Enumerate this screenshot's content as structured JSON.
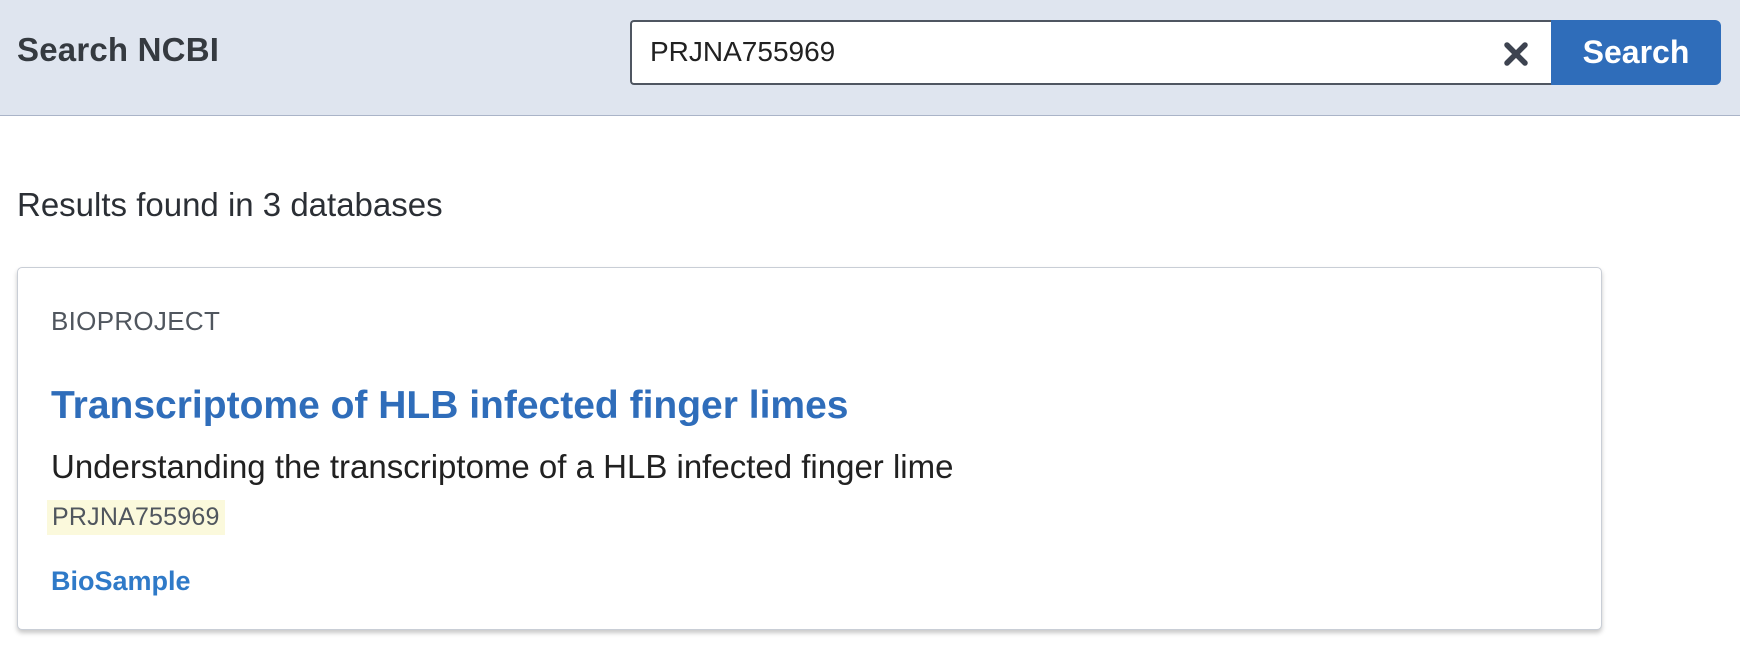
{
  "header": {
    "label": "Search NCBI",
    "search_value": "PRJNA755969",
    "search_button_label": "Search",
    "clear_icon": "close-icon"
  },
  "results": {
    "heading": "Results found in 3 databases",
    "cards": [
      {
        "database": "BIOPROJECT",
        "title": "Transcriptome of HLB infected finger limes",
        "description": "Understanding the transcriptome of a HLB infected finger lime",
        "accession": "PRJNA755969",
        "linked_database": "BioSample"
      }
    ]
  },
  "colors": {
    "header_bg": "#dfe5ef",
    "accent_blue": "#2f6dba",
    "link_blue": "#2f7ac8",
    "highlight": "#fbf9dc"
  }
}
